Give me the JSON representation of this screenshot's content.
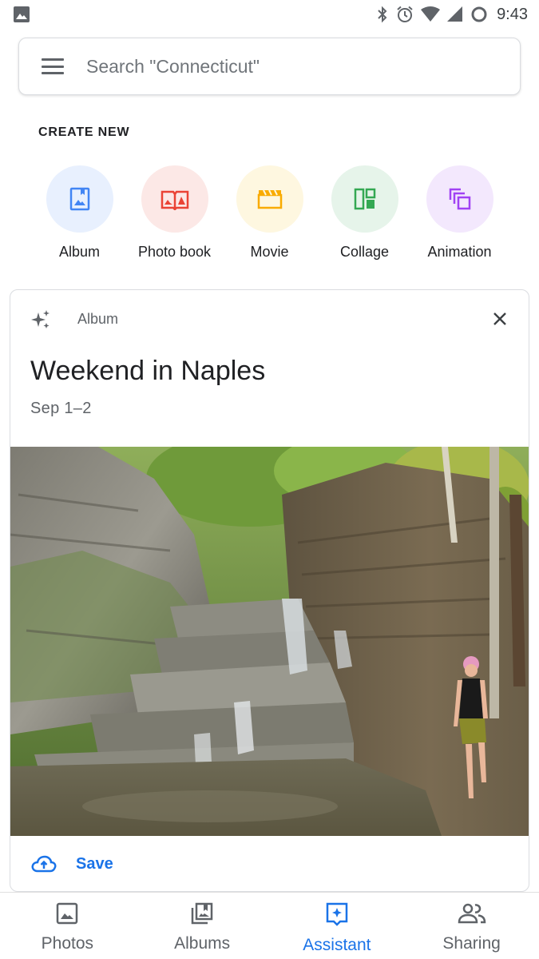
{
  "status_bar": {
    "time": "9:43",
    "icons": [
      "image-notification-icon",
      "bluetooth-icon",
      "alarm-icon",
      "wifi-icon",
      "signal-icon",
      "battery-icon"
    ]
  },
  "search": {
    "placeholder": "Search \"Connecticut\"",
    "value": ""
  },
  "create_new": {
    "heading": "CREATE NEW",
    "items": [
      {
        "label": "Album",
        "icon": "album-icon",
        "bg": "#e8f0fe",
        "color": "#4285f4"
      },
      {
        "label": "Photo book",
        "icon": "photo-book-icon",
        "bg": "#fce8e6",
        "color": "#ea4335"
      },
      {
        "label": "Movie",
        "icon": "movie-icon",
        "bg": "#fef7e0",
        "color": "#f9ab00"
      },
      {
        "label": "Collage",
        "icon": "collage-icon",
        "bg": "#e6f4ea",
        "color": "#34a853"
      },
      {
        "label": "Animation",
        "icon": "animation-icon",
        "bg": "#f3e8fd",
        "color": "#a142f4"
      }
    ]
  },
  "card": {
    "type_label": "Album",
    "title": "Weekend in Naples",
    "date": "Sep 1–2",
    "save_label": "Save"
  },
  "bottom_nav": {
    "items": [
      {
        "label": "Photos",
        "icon": "photos-icon",
        "active": false
      },
      {
        "label": "Albums",
        "icon": "albums-icon",
        "active": false
      },
      {
        "label": "Assistant",
        "icon": "assistant-icon",
        "active": true
      },
      {
        "label": "Sharing",
        "icon": "sharing-icon",
        "active": false
      }
    ]
  },
  "colors": {
    "accent": "#1a73e8",
    "text_primary": "#202124",
    "text_secondary": "#5f6368",
    "border": "#dadce0"
  }
}
